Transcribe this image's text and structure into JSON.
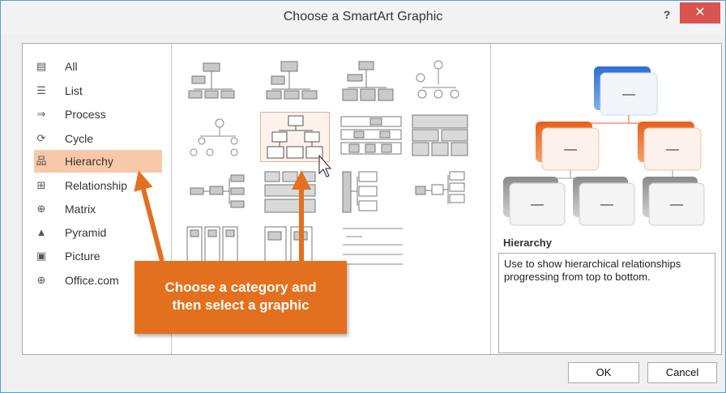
{
  "dialog": {
    "title": "Choose a SmartArt Graphic",
    "help_label": "?",
    "close_label": "✕"
  },
  "categories": [
    {
      "label": "All",
      "icon": "all-icon",
      "glyph": "▤"
    },
    {
      "label": "List",
      "icon": "list-icon",
      "glyph": "☰"
    },
    {
      "label": "Process",
      "icon": "process-icon",
      "glyph": "⇒"
    },
    {
      "label": "Cycle",
      "icon": "cycle-icon",
      "glyph": "⟳"
    },
    {
      "label": "Hierarchy",
      "icon": "hierarchy-icon",
      "glyph": "品",
      "selected": true
    },
    {
      "label": "Relationship",
      "icon": "relationship-icon",
      "glyph": "⊞"
    },
    {
      "label": "Matrix",
      "icon": "matrix-icon",
      "glyph": "⊕"
    },
    {
      "label": "Pyramid",
      "icon": "pyramid-icon",
      "glyph": "▲"
    },
    {
      "label": "Picture",
      "icon": "picture-icon",
      "glyph": "▣"
    },
    {
      "label": "Office.com",
      "icon": "globe-icon",
      "glyph": "⊕"
    }
  ],
  "preview": {
    "title": "Hierarchy",
    "description": "Use to show hierarchical relationships progressing from top to bottom.",
    "placeholder": "—"
  },
  "buttons": {
    "ok": "OK",
    "cancel": "Cancel"
  },
  "callout": {
    "line1": "Choose a category and",
    "line2": "then select a graphic"
  },
  "colors": {
    "accent_orange": "#e3701e",
    "preview_blue": "#3a7fd5",
    "preview_orange": "#e8601c",
    "preview_gray": "#8a8a8a",
    "selected_category_bg": "#f8c9a8"
  }
}
